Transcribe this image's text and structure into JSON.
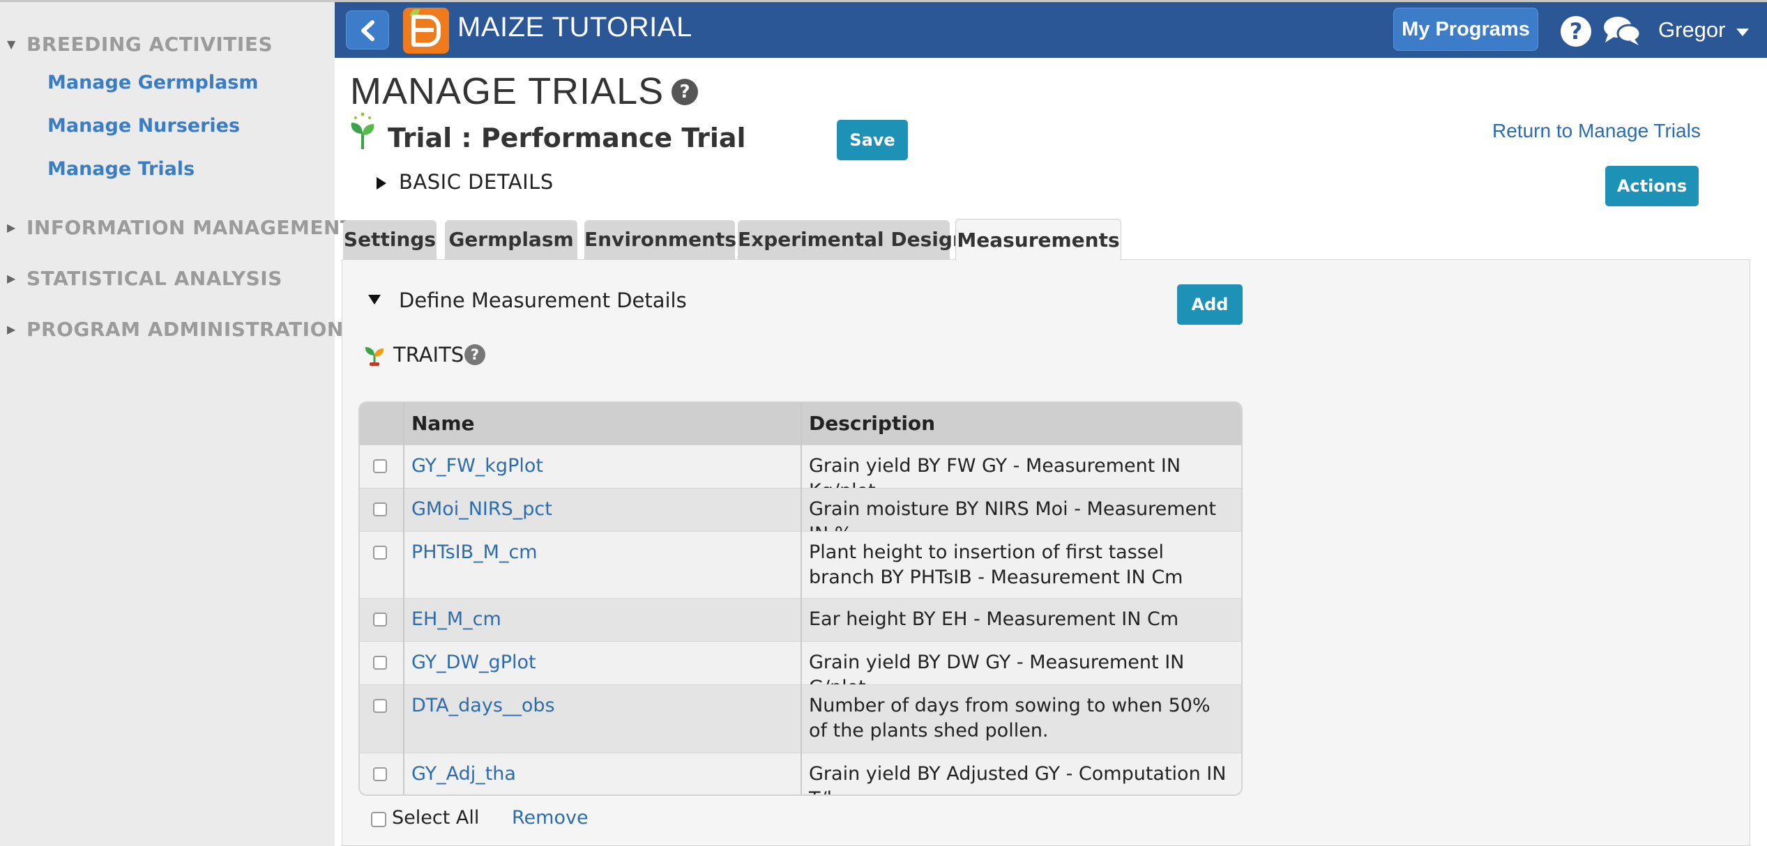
{
  "sidebar": {
    "sections": [
      {
        "label": "BREEDING ACTIVITIES",
        "expanded": true,
        "items": [
          "Manage Germplasm",
          "Manage Nurseries",
          "Manage Trials"
        ]
      },
      {
        "label": "INFORMATION MANAGEMENT",
        "expanded": false
      },
      {
        "label": "STATISTICAL ANALYSIS",
        "expanded": false
      },
      {
        "label": "PROGRAM ADMINISTRATION",
        "expanded": false
      }
    ]
  },
  "header": {
    "app_title": "MAIZE TUTORIAL",
    "my_programs": "My Programs",
    "help": "?",
    "user": "Gregor",
    "colors": {
      "bar": "#2b5797",
      "button": "#3d7cc9",
      "logo": "#f07b1c"
    }
  },
  "page": {
    "title": "MANAGE TRIALS",
    "help": "?",
    "trial_name": "Trial : Performance Trial",
    "save": "Save",
    "return_link": "Return to Manage Trials",
    "actions": "Actions",
    "basic_details": "BASIC DETAILS"
  },
  "tabs": [
    {
      "label": "Settings",
      "active": false
    },
    {
      "label": "Germplasm",
      "active": false
    },
    {
      "label": "Environments",
      "active": false
    },
    {
      "label": "Experimental Design",
      "active": false
    },
    {
      "label": "Measurements",
      "active": true
    }
  ],
  "measurements": {
    "section_title": "Define Measurement Details",
    "add": "Add",
    "traits_label": "TRAITS",
    "traits_help": "?",
    "columns": [
      "Name",
      "Description"
    ],
    "rows": [
      {
        "name": "GY_FW_kgPlot",
        "description": "Grain yield BY FW GY - Measurement IN Kg/plot"
      },
      {
        "name": "GMoi_NIRS_pct",
        "description": "Grain moisture BY NIRS Moi - Measurement IN %"
      },
      {
        "name": "PHTsIB_M_cm",
        "description": "Plant height to insertion of first tassel branch BY PHTsIB - Measurement IN Cm"
      },
      {
        "name": "EH_M_cm",
        "description": "Ear height BY EH - Measurement IN Cm"
      },
      {
        "name": "GY_DW_gPlot",
        "description": "Grain yield BY DW GY - Measurement IN G/plot"
      },
      {
        "name": "DTA_days__obs",
        "description": "Number of days from sowing to when 50% of the plants shed pollen."
      },
      {
        "name": "GY_Adj_tha",
        "description": "Grain yield BY Adjusted GY - Computation IN T/ha"
      }
    ],
    "select_all": "Select All",
    "remove": "Remove",
    "accent_color": "#1d92b6"
  }
}
